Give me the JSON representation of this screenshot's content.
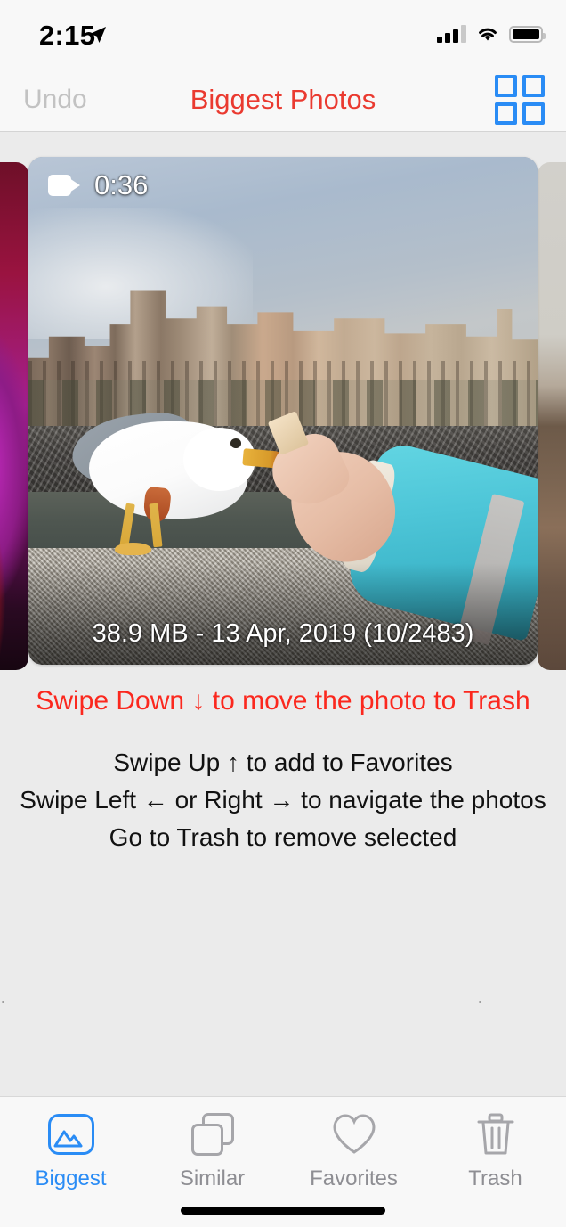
{
  "status_bar": {
    "time": "2:15",
    "location_icon": "location-arrow-icon",
    "cellular_icon": "cellular-bars-icon",
    "cellular_bars_filled": 3,
    "cellular_bars_total": 4,
    "wifi_icon": "wifi-icon",
    "battery_icon": "battery-icon",
    "battery_level_percent": 82
  },
  "nav_bar": {
    "undo_label": "Undo",
    "undo_enabled": false,
    "title": "Biggest Photos",
    "title_color": "#ea3a30",
    "grid_icon": "grid-view-icon",
    "grid_color": "#2a8cf5"
  },
  "photo_card": {
    "media_type_icon": "video-camera-icon",
    "duration": "0:36",
    "caption": "38.9 MB - 13 Apr, 2019 (10/2483)",
    "file_size": "38.9 MB",
    "date": "13 Apr, 2019",
    "position": "10/2483",
    "index": 10,
    "total": 2483
  },
  "hints": {
    "primary": "Swipe Down ↓ to move the photo to Trash",
    "primary_color": "#fb281e",
    "lines": [
      "Swipe Up ↑ to add to Favorites",
      "Swipe Left ← or Right → to navigate the photos",
      "Go to Trash to remove selected"
    ]
  },
  "tab_bar": {
    "active_index": 0,
    "active_color": "#2a8cf5",
    "inactive_color": "#8e8e93",
    "tabs": [
      {
        "label": "Biggest",
        "icon": "mountains-icon"
      },
      {
        "label": "Similar",
        "icon": "stacked-squares-icon"
      },
      {
        "label": "Favorites",
        "icon": "heart-icon"
      },
      {
        "label": "Trash",
        "icon": "trash-can-icon"
      }
    ]
  }
}
